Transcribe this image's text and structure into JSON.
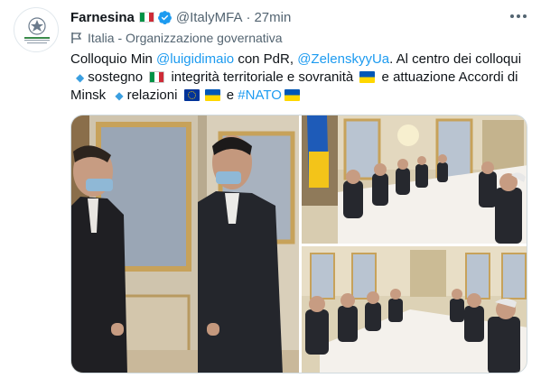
{
  "account": {
    "name": "Farnesina",
    "handle": "@ItalyMFA",
    "separator": "·",
    "time": "27min",
    "label": "Italia - Organizzazione governativa",
    "avatar_caption": "Ministero degli Affari Esteri e della Cooperazione Internazionale"
  },
  "tweet": {
    "line1": {
      "pre": "Colloquio Min ",
      "mention1": "@luigidimaio",
      "mid": " con PdR, ",
      "mention2": "@ZelenskyyUa",
      "post": ". Al centro dei colloqui"
    },
    "line2": {
      "a": "sostegno ",
      "b": " integrità territoriale e sovranità ",
      "c": " e attuazione Accordi di"
    },
    "line3": {
      "a": "Minsk ",
      "b": "relazioni ",
      "c": " e ",
      "hashtag": "#NATO"
    }
  },
  "icons": {
    "more": "more-dots-icon",
    "verified": "verified-badge-icon",
    "label": "flag-outline-icon",
    "diamond": "small-blue-diamond-icon"
  },
  "colors": {
    "link": "#1d9bf0",
    "secondary_text": "#536471",
    "verified": "#1d9bf0"
  }
}
